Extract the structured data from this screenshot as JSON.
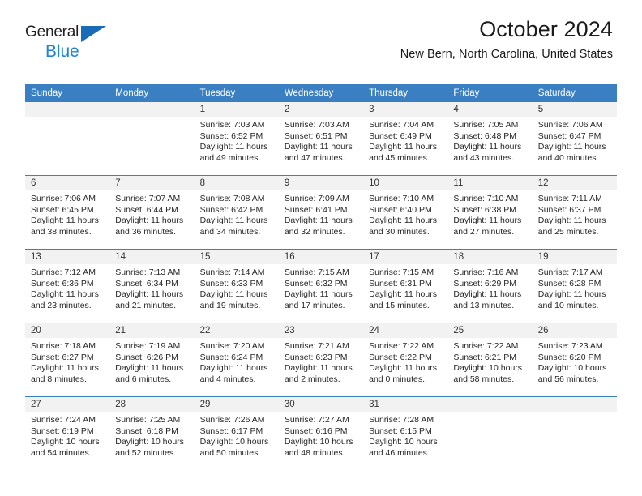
{
  "brand": {
    "name_part1": "General",
    "name_part2": "Blue",
    "logo_icon": "triangle-logo-icon",
    "colors": {
      "accent_blue": "#1e84d6",
      "triangle_blue": "#1a6bb5"
    }
  },
  "header": {
    "title": "October 2024",
    "subtitle": "New Bern, North Carolina, United States"
  },
  "calendar": {
    "header_bg": "#3a7fc1",
    "daynum_bg": "#f2f2f2",
    "weekdays": [
      "Sunday",
      "Monday",
      "Tuesday",
      "Wednesday",
      "Thursday",
      "Friday",
      "Saturday"
    ],
    "labels": {
      "sunrise": "Sunrise:",
      "sunset": "Sunset:",
      "daylight": "Daylight:"
    },
    "weeks": [
      [
        {
          "day": "",
          "sunrise": "",
          "sunset": "",
          "daylight_line1": "",
          "daylight_line2": ""
        },
        {
          "day": "",
          "sunrise": "",
          "sunset": "",
          "daylight_line1": "",
          "daylight_line2": ""
        },
        {
          "day": "1",
          "sunrise": "Sunrise: 7:03 AM",
          "sunset": "Sunset: 6:52 PM",
          "daylight_line1": "Daylight: 11 hours",
          "daylight_line2": "and 49 minutes."
        },
        {
          "day": "2",
          "sunrise": "Sunrise: 7:03 AM",
          "sunset": "Sunset: 6:51 PM",
          "daylight_line1": "Daylight: 11 hours",
          "daylight_line2": "and 47 minutes."
        },
        {
          "day": "3",
          "sunrise": "Sunrise: 7:04 AM",
          "sunset": "Sunset: 6:49 PM",
          "daylight_line1": "Daylight: 11 hours",
          "daylight_line2": "and 45 minutes."
        },
        {
          "day": "4",
          "sunrise": "Sunrise: 7:05 AM",
          "sunset": "Sunset: 6:48 PM",
          "daylight_line1": "Daylight: 11 hours",
          "daylight_line2": "and 43 minutes."
        },
        {
          "day": "5",
          "sunrise": "Sunrise: 7:06 AM",
          "sunset": "Sunset: 6:47 PM",
          "daylight_line1": "Daylight: 11 hours",
          "daylight_line2": "and 40 minutes."
        }
      ],
      [
        {
          "day": "6",
          "sunrise": "Sunrise: 7:06 AM",
          "sunset": "Sunset: 6:45 PM",
          "daylight_line1": "Daylight: 11 hours",
          "daylight_line2": "and 38 minutes."
        },
        {
          "day": "7",
          "sunrise": "Sunrise: 7:07 AM",
          "sunset": "Sunset: 6:44 PM",
          "daylight_line1": "Daylight: 11 hours",
          "daylight_line2": "and 36 minutes."
        },
        {
          "day": "8",
          "sunrise": "Sunrise: 7:08 AM",
          "sunset": "Sunset: 6:42 PM",
          "daylight_line1": "Daylight: 11 hours",
          "daylight_line2": "and 34 minutes."
        },
        {
          "day": "9",
          "sunrise": "Sunrise: 7:09 AM",
          "sunset": "Sunset: 6:41 PM",
          "daylight_line1": "Daylight: 11 hours",
          "daylight_line2": "and 32 minutes."
        },
        {
          "day": "10",
          "sunrise": "Sunrise: 7:10 AM",
          "sunset": "Sunset: 6:40 PM",
          "daylight_line1": "Daylight: 11 hours",
          "daylight_line2": "and 30 minutes."
        },
        {
          "day": "11",
          "sunrise": "Sunrise: 7:10 AM",
          "sunset": "Sunset: 6:38 PM",
          "daylight_line1": "Daylight: 11 hours",
          "daylight_line2": "and 27 minutes."
        },
        {
          "day": "12",
          "sunrise": "Sunrise: 7:11 AM",
          "sunset": "Sunset: 6:37 PM",
          "daylight_line1": "Daylight: 11 hours",
          "daylight_line2": "and 25 minutes."
        }
      ],
      [
        {
          "day": "13",
          "sunrise": "Sunrise: 7:12 AM",
          "sunset": "Sunset: 6:36 PM",
          "daylight_line1": "Daylight: 11 hours",
          "daylight_line2": "and 23 minutes."
        },
        {
          "day": "14",
          "sunrise": "Sunrise: 7:13 AM",
          "sunset": "Sunset: 6:34 PM",
          "daylight_line1": "Daylight: 11 hours",
          "daylight_line2": "and 21 minutes."
        },
        {
          "day": "15",
          "sunrise": "Sunrise: 7:14 AM",
          "sunset": "Sunset: 6:33 PM",
          "daylight_line1": "Daylight: 11 hours",
          "daylight_line2": "and 19 minutes."
        },
        {
          "day": "16",
          "sunrise": "Sunrise: 7:15 AM",
          "sunset": "Sunset: 6:32 PM",
          "daylight_line1": "Daylight: 11 hours",
          "daylight_line2": "and 17 minutes."
        },
        {
          "day": "17",
          "sunrise": "Sunrise: 7:15 AM",
          "sunset": "Sunset: 6:31 PM",
          "daylight_line1": "Daylight: 11 hours",
          "daylight_line2": "and 15 minutes."
        },
        {
          "day": "18",
          "sunrise": "Sunrise: 7:16 AM",
          "sunset": "Sunset: 6:29 PM",
          "daylight_line1": "Daylight: 11 hours",
          "daylight_line2": "and 13 minutes."
        },
        {
          "day": "19",
          "sunrise": "Sunrise: 7:17 AM",
          "sunset": "Sunset: 6:28 PM",
          "daylight_line1": "Daylight: 11 hours",
          "daylight_line2": "and 10 minutes."
        }
      ],
      [
        {
          "day": "20",
          "sunrise": "Sunrise: 7:18 AM",
          "sunset": "Sunset: 6:27 PM",
          "daylight_line1": "Daylight: 11 hours",
          "daylight_line2": "and 8 minutes."
        },
        {
          "day": "21",
          "sunrise": "Sunrise: 7:19 AM",
          "sunset": "Sunset: 6:26 PM",
          "daylight_line1": "Daylight: 11 hours",
          "daylight_line2": "and 6 minutes."
        },
        {
          "day": "22",
          "sunrise": "Sunrise: 7:20 AM",
          "sunset": "Sunset: 6:24 PM",
          "daylight_line1": "Daylight: 11 hours",
          "daylight_line2": "and 4 minutes."
        },
        {
          "day": "23",
          "sunrise": "Sunrise: 7:21 AM",
          "sunset": "Sunset: 6:23 PM",
          "daylight_line1": "Daylight: 11 hours",
          "daylight_line2": "and 2 minutes."
        },
        {
          "day": "24",
          "sunrise": "Sunrise: 7:22 AM",
          "sunset": "Sunset: 6:22 PM",
          "daylight_line1": "Daylight: 11 hours",
          "daylight_line2": "and 0 minutes."
        },
        {
          "day": "25",
          "sunrise": "Sunrise: 7:22 AM",
          "sunset": "Sunset: 6:21 PM",
          "daylight_line1": "Daylight: 10 hours",
          "daylight_line2": "and 58 minutes."
        },
        {
          "day": "26",
          "sunrise": "Sunrise: 7:23 AM",
          "sunset": "Sunset: 6:20 PM",
          "daylight_line1": "Daylight: 10 hours",
          "daylight_line2": "and 56 minutes."
        }
      ],
      [
        {
          "day": "27",
          "sunrise": "Sunrise: 7:24 AM",
          "sunset": "Sunset: 6:19 PM",
          "daylight_line1": "Daylight: 10 hours",
          "daylight_line2": "and 54 minutes."
        },
        {
          "day": "28",
          "sunrise": "Sunrise: 7:25 AM",
          "sunset": "Sunset: 6:18 PM",
          "daylight_line1": "Daylight: 10 hours",
          "daylight_line2": "and 52 minutes."
        },
        {
          "day": "29",
          "sunrise": "Sunrise: 7:26 AM",
          "sunset": "Sunset: 6:17 PM",
          "daylight_line1": "Daylight: 10 hours",
          "daylight_line2": "and 50 minutes."
        },
        {
          "day": "30",
          "sunrise": "Sunrise: 7:27 AM",
          "sunset": "Sunset: 6:16 PM",
          "daylight_line1": "Daylight: 10 hours",
          "daylight_line2": "and 48 minutes."
        },
        {
          "day": "31",
          "sunrise": "Sunrise: 7:28 AM",
          "sunset": "Sunset: 6:15 PM",
          "daylight_line1": "Daylight: 10 hours",
          "daylight_line2": "and 46 minutes."
        },
        {
          "day": "",
          "sunrise": "",
          "sunset": "",
          "daylight_line1": "",
          "daylight_line2": ""
        },
        {
          "day": "",
          "sunrise": "",
          "sunset": "",
          "daylight_line1": "",
          "daylight_line2": ""
        }
      ]
    ]
  }
}
